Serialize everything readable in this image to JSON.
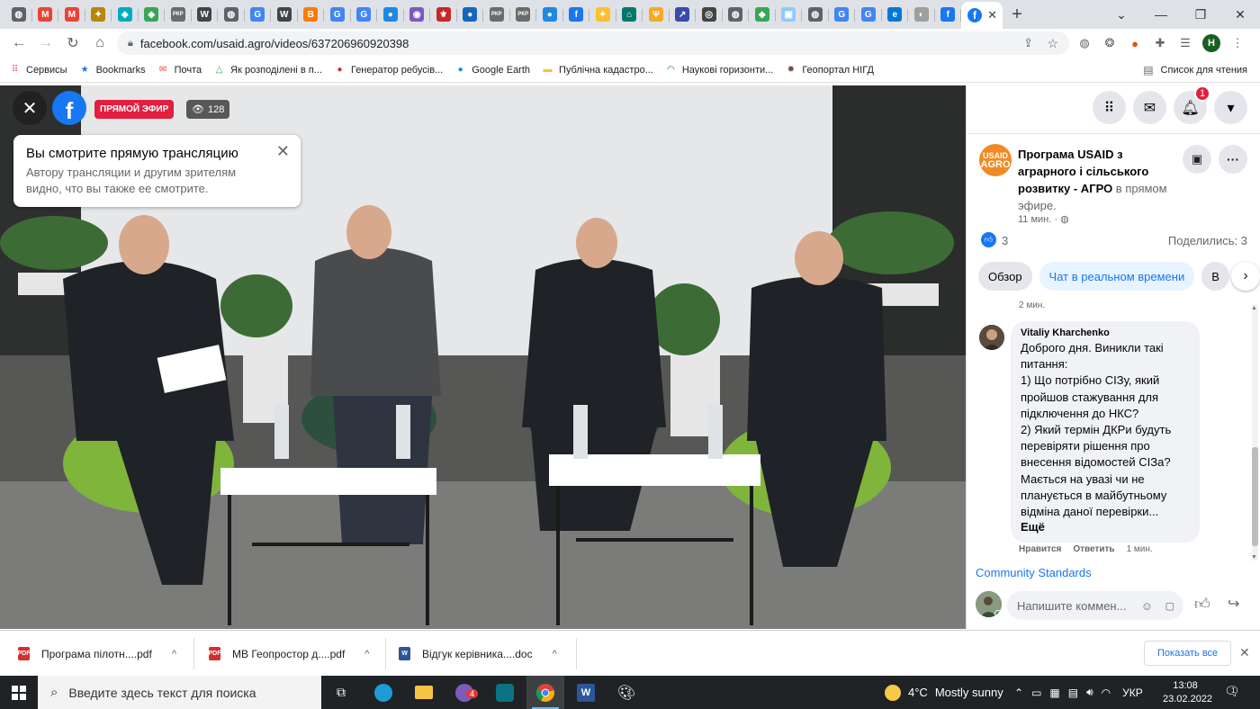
{
  "browser": {
    "tabs": [
      {
        "icon": "globe-icon",
        "color": "#5f6368",
        "glyph": "◍"
      },
      {
        "icon": "gmail-icon",
        "color": "#ea4335",
        "glyph": "M"
      },
      {
        "icon": "gmail-icon",
        "color": "#ea4335",
        "glyph": "M"
      },
      {
        "icon": "emblem-icon",
        "color": "#b8860b",
        "glyph": "✦"
      },
      {
        "icon": "site-icon",
        "color": "#00acc1",
        "glyph": "◈"
      },
      {
        "icon": "maps-icon",
        "color": "#34a853",
        "glyph": "◆"
      },
      {
        "icon": "pkp-icon",
        "color": "#6b6b6b",
        "glyph": "РКР"
      },
      {
        "icon": "wikipedia-icon",
        "color": "#444",
        "glyph": "W"
      },
      {
        "icon": "globe-icon",
        "color": "#5f6368",
        "glyph": "◍"
      },
      {
        "icon": "google-icon",
        "color": "#4285f4",
        "glyph": "G"
      },
      {
        "icon": "wikipedia-icon",
        "color": "#444",
        "glyph": "W"
      },
      {
        "icon": "blogger-icon",
        "color": "#ff7a00",
        "glyph": "B"
      },
      {
        "icon": "google-icon",
        "color": "#4285f4",
        "glyph": "G"
      },
      {
        "icon": "google-icon",
        "color": "#4285f4",
        "glyph": "G"
      },
      {
        "icon": "earth-icon",
        "color": "#1e88e5",
        "glyph": "●"
      },
      {
        "icon": "site-icon",
        "color": "#7e57c2",
        "glyph": "◉"
      },
      {
        "icon": "emblem-icon",
        "color": "#c62828",
        "glyph": "⚜"
      },
      {
        "icon": "site-icon",
        "color": "#1565c0",
        "glyph": "●"
      },
      {
        "icon": "pkp-icon",
        "color": "#6b6b6b",
        "glyph": "РКР"
      },
      {
        "icon": "pkp-icon",
        "color": "#6b6b6b",
        "glyph": "РКР"
      },
      {
        "icon": "earth-icon",
        "color": "#1e88e5",
        "glyph": "●"
      },
      {
        "icon": "facebook-icon",
        "color": "#1877f2",
        "glyph": "f"
      },
      {
        "icon": "site-icon",
        "color": "#fbc02d",
        "glyph": "✦"
      },
      {
        "icon": "site-icon",
        "color": "#00796b",
        "glyph": "⌂"
      },
      {
        "icon": "trident-icon",
        "color": "#f9a825",
        "glyph": "Ѱ"
      },
      {
        "icon": "site-icon",
        "color": "#3949ab",
        "glyph": "↗"
      },
      {
        "icon": "chrome-icon",
        "color": "#444",
        "glyph": "◎"
      },
      {
        "icon": "globe-icon",
        "color": "#5f6368",
        "glyph": "◍"
      },
      {
        "icon": "maps-icon",
        "color": "#34a853",
        "glyph": "◆"
      },
      {
        "icon": "site-icon",
        "color": "#90caf9",
        "glyph": "▣"
      },
      {
        "icon": "globe-icon",
        "color": "#5f6368",
        "glyph": "◍"
      },
      {
        "icon": "google-icon",
        "color": "#4285f4",
        "glyph": "G"
      },
      {
        "icon": "google-icon",
        "color": "#4285f4",
        "glyph": "G"
      },
      {
        "icon": "edge-icon",
        "color": "#0078d7",
        "glyph": "e"
      },
      {
        "icon": "site-icon",
        "color": "#9e9e9e",
        "glyph": "◐"
      },
      {
        "icon": "facebook-icon",
        "color": "#1877f2",
        "glyph": "f"
      }
    ],
    "active_tab": {
      "icon": "facebook-icon",
      "color": "#1877f2",
      "glyph": "f",
      "close": "✕"
    },
    "new_tab": "+",
    "url": "facebook.com/usaid.agro/videos/637206960920398",
    "profile_initial": "Н",
    "bookmarks": [
      {
        "icon": "apps-icon",
        "label": "Сервисы"
      },
      {
        "icon": "star-icon",
        "label": "Bookmarks"
      },
      {
        "icon": "mail-icon",
        "label": "Почта"
      },
      {
        "icon": "triangle-icon",
        "label": "Як розподілені в п..."
      },
      {
        "icon": "puzzle-icon",
        "label": "Генератор ребусів..."
      },
      {
        "icon": "earth-icon",
        "label": "Google Earth"
      },
      {
        "icon": "flag-icon",
        "label": "Публічна кадастро..."
      },
      {
        "icon": "site-icon",
        "label": "Наукові горизонти..."
      },
      {
        "icon": "gear-icon",
        "label": "Геопортал НІГД"
      }
    ],
    "reading_list": "Список для чтения"
  },
  "video": {
    "live_label": "ПРЯМОЙ ЭФИР",
    "viewers": "128",
    "notice_title": "Вы смотрите прямую трансляцию",
    "notice_body": "Автору трансляции и другим зрителям видно, что вы также ее смотрите."
  },
  "sidebar": {
    "notifications_count": "1",
    "page_avatar_text": [
      "USAID",
      "AGRO"
    ],
    "page_name": "Програма USAID з аграрного і сільського розвитку - АГРО",
    "page_status": " в прямом эфире.",
    "post_time": "11 мин. · ",
    "likes": "3",
    "shares": "Поделились: 3",
    "tabs": [
      "Обзор",
      "Чат в реальном времени",
      "В"
    ],
    "prev_comment_time": "2 мин.",
    "comment": {
      "author": "Vitaliy Kharchenko",
      "text": "Доброго дня. Виникли такі питання:\n1) Що потрібно СІЗу, який пройшов стажування для підключення до НКС?\n2) Який термін ДКРи будуть перевіряти рішення про внесення відомостей СІЗа? Мається на увазі чи не планується в майбутньому відміна даної перевірки...",
      "see_more": "Ещё",
      "like": "Нравится",
      "reply": "Ответить",
      "time": "1 мин."
    },
    "community_standards": "Community Standards",
    "comment_placeholder": "Напишите коммен..."
  },
  "downloads": {
    "items": [
      {
        "name": "Програма пілотн....pdf",
        "type": "pdf"
      },
      {
        "name": "МВ Геопростор д....pdf",
        "type": "pdf"
      },
      {
        "name": "Відгук керівника....doc",
        "type": "doc"
      }
    ],
    "show_all": "Показать все"
  },
  "taskbar": {
    "search_placeholder": "Введите здесь текст для поиска",
    "viber_badge": "4",
    "temperature": "4°C",
    "weather": "Mostly sunny",
    "lang": "УКР",
    "time": "13:08",
    "date": "23.02.2022",
    "notification_count": "1"
  },
  "colors": {
    "facebook_blue": "#1877f2",
    "live_red": "#e41e3f",
    "usaid_orange": "#f08a24"
  }
}
